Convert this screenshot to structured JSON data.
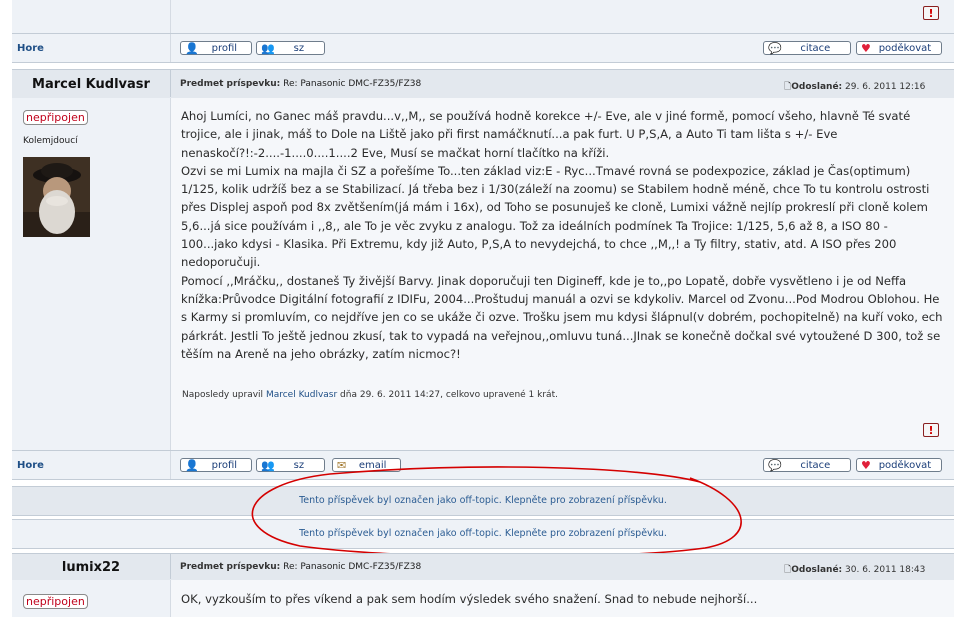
{
  "top_strip": {
    "hore_label": "Hore"
  },
  "buttons": {
    "profile": "profil",
    "pm": "sz",
    "email": "email",
    "quote": "citace",
    "thanks": "poděkovat"
  },
  "post1": {
    "author": "Marcel Kudlvasr",
    "subject_label": "Predmet príspevku:",
    "subject": "Re: Panasonic DMC-FZ35/FZ38",
    "posted_label": "Odoslané:",
    "posted": "29. 6. 2011 12:16",
    "status": "nepřipojen",
    "rank": "Kolemjdoucí",
    "body": "Ahoj Lumíci, no Ganec máš pravdu...v,,M,, se používá hodně korekce +/- Eve, ale v jiné formě, pomocí všeho, hlavně Té svaté trojice, ale i jinak, máš to Dole na Liště jako při first namáčknutí...a pak furt. U P,S,A, a Auto Ti tam lišta s +/- Eve nenaskočí?!:-2....-1....0....1....2 Eve, Musí se mačkat horní tlačítko na kříži.\nOzvi se mi Lumix na majla či SZ a pořešíme To...ten základ viz:E - Ryc...Tmavé rovná se podexpozice, základ je Čas(optimum) 1/125, kolik udržíš bez a se Stabilizací. Já třeba bez i 1/30(záleží na zoomu) se Stabilem hodně méně, chce To tu kontrolu ostrosti přes Displej aspoň pod 8x zvětšením(já mám i 16x), od Toho se posunuješ ke cloně, Lumixi vážně nejlíp prokreslí při cloně kolem 5,6...já sice používám i ,,8,, ale To je věc zvyku z analogu. Tož za ideálních podmínek Ta Trojice: 1/125, 5,6 až 8, a ISO 80 - 100...jako kdysi - Klasika. Při Extremu, kdy již Auto, P,S,A to nevydejchá, to chce ,,M,,! a Ty filtry, stativ, atd. A ISO přes 200 nedoporučuji.\nPomocí ,,Mráčku,, dostaneš Ty živější Barvy. Jinak doporučuji ten Digineff, kde je to,,po Lopatě, dobře vysvětleno i je od Neffa knížka:Průvodce Digitální fotografií z IDIFu, 2004...Proštuduj manuál a ozvi se kdykoliv. Marcel od Zvonu...Pod Modrou Oblohou. He s Karmy si promluvím, co nejdříve jen co se ukáže či ozve. Trošku jsem mu kdysi šlápnul(v dobrém, pochopitelně) na kuří voko, ech párkrát. Jestli To ještě jednou zkusí, tak to vypadá na veřejnou,,omluvu tuná...JInak se konečně dočkal své vytoužené D 300, tož se těším na Areně na jeho obrázky, zatím nicmoc?!",
    "edit_prefix": "Naposledy upravil",
    "edit_user": "Marcel Kudlvasr",
    "edit_suffix": "dňa 29. 6. 2011 14:27, celkovo upravené 1 krát.",
    "hore_label": "Hore"
  },
  "offtopic": {
    "notice1": "Tento příspěvek byl označen jako off-topic. Klepněte pro zobrazení příspěvku.",
    "notice2": "Tento příspěvek byl označen jako off-topic. Klepněte pro zobrazení příspěvku."
  },
  "post2": {
    "author": "lumix22",
    "subject_label": "Predmet príspevku:",
    "subject": "Re: Panasonic DMC-FZ35/FZ38",
    "posted_label": "Odoslané:",
    "posted": "30. 6. 2011 18:43",
    "status": "nepřipojen",
    "body": "OK, vyzkouším to přes víkend a pak sem hodím výsledek svého snažení. Snad to nebude nejhorší..."
  },
  "colors": {
    "annotation": "#d40000",
    "link": "#1f4f86",
    "panel": "#eef2f7"
  }
}
